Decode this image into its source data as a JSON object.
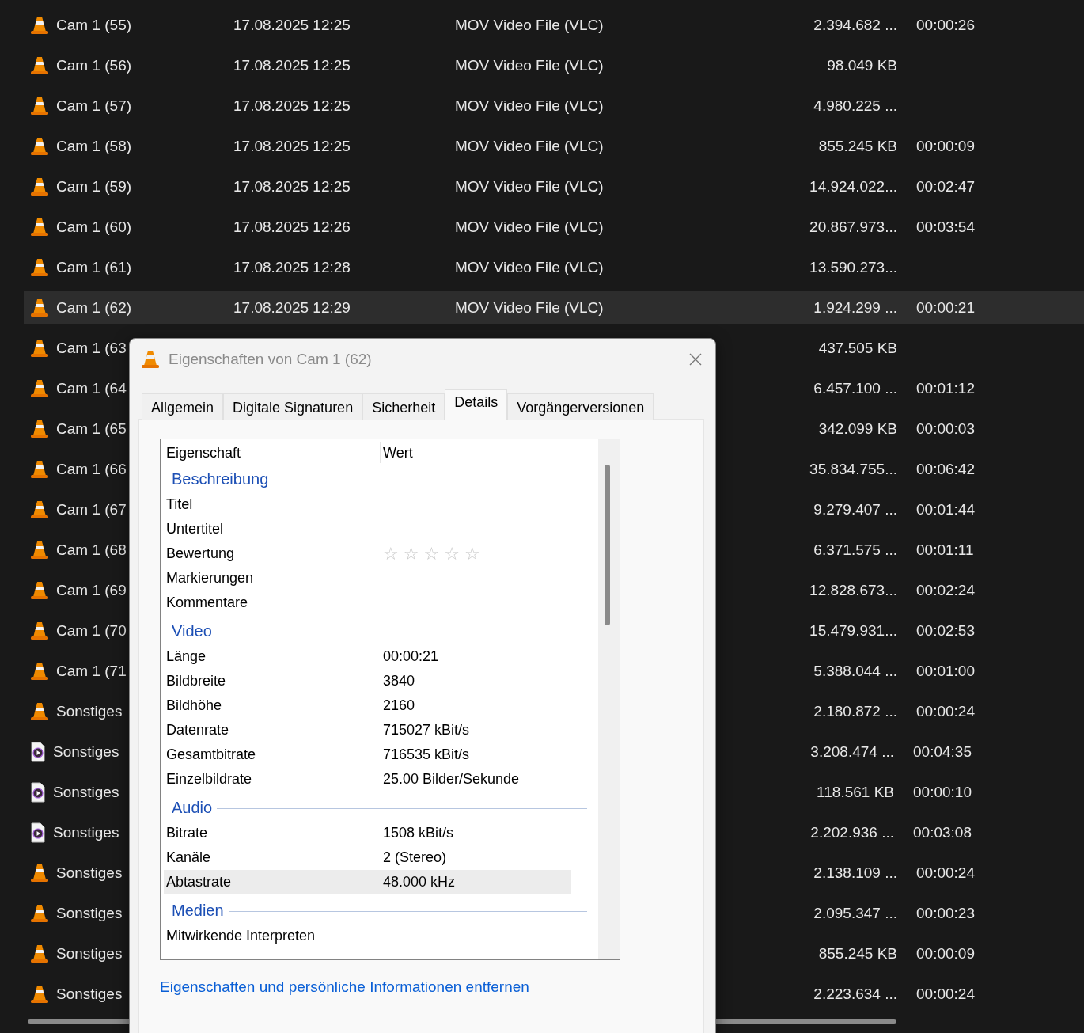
{
  "files": [
    {
      "kind": "vlc",
      "name": "Cam 1 (55)",
      "date": "17.08.2025 12:25",
      "type": "MOV Video File (VLC)",
      "size": "2.394.682 ...",
      "length": "00:00:26",
      "selected": false
    },
    {
      "kind": "vlc",
      "name": "Cam 1 (56)",
      "date": "17.08.2025 12:25",
      "type": "MOV Video File (VLC)",
      "size": "98.049 KB",
      "selected": false
    },
    {
      "kind": "vlc",
      "name": "Cam 1 (57)",
      "date": "17.08.2025 12:25",
      "type": "MOV Video File (VLC)",
      "size": "4.980.225 ...",
      "selected": false
    },
    {
      "kind": "vlc",
      "name": "Cam 1 (58)",
      "date": "17.08.2025 12:25",
      "type": "MOV Video File (VLC)",
      "size": "855.245 KB",
      "length": "00:00:09",
      "selected": false
    },
    {
      "kind": "vlc",
      "name": "Cam 1 (59)",
      "date": "17.08.2025 12:25",
      "type": "MOV Video File (VLC)",
      "size": "14.924.022...",
      "length": "00:02:47",
      "selected": false
    },
    {
      "kind": "vlc",
      "name": "Cam 1 (60)",
      "date": "17.08.2025 12:26",
      "type": "MOV Video File (VLC)",
      "size": "20.867.973...",
      "length": "00:03:54",
      "selected": false
    },
    {
      "kind": "vlc",
      "name": "Cam 1 (61)",
      "date": "17.08.2025 12:28",
      "type": "MOV Video File (VLC)",
      "size": "13.590.273...",
      "selected": false
    },
    {
      "kind": "vlc",
      "name": "Cam 1 (62)",
      "date": "17.08.2025 12:29",
      "type": "MOV Video File (VLC)",
      "size": "1.924.299 ...",
      "length": "00:00:21",
      "selected": true
    },
    {
      "kind": "vlc",
      "name": "Cam 1 (63",
      "size": "437.505 KB",
      "selected": false
    },
    {
      "kind": "vlc",
      "name": "Cam 1 (64",
      "size": "6.457.100 ...",
      "length": "00:01:12",
      "selected": false
    },
    {
      "kind": "vlc",
      "name": "Cam 1 (65",
      "size": "342.099 KB",
      "length": "00:00:03",
      "selected": false
    },
    {
      "kind": "vlc",
      "name": "Cam 1 (66",
      "size": "35.834.755...",
      "length": "00:06:42",
      "selected": false
    },
    {
      "kind": "vlc",
      "name": "Cam 1 (67",
      "size": "9.279.407 ...",
      "length": "00:01:44",
      "selected": false
    },
    {
      "kind": "vlc",
      "name": "Cam 1 (68",
      "size": "6.371.575 ...",
      "length": "00:01:11",
      "selected": false
    },
    {
      "kind": "vlc",
      "name": "Cam 1 (69",
      "size": "12.828.673...",
      "length": "00:02:24",
      "selected": false
    },
    {
      "kind": "vlc",
      "name": "Cam 1 (70",
      "size": "15.479.931...",
      "length": "00:02:53",
      "selected": false
    },
    {
      "kind": "vlc",
      "name": "Cam 1 (71",
      "size": "5.388.044 ...",
      "length": "00:01:00",
      "selected": false
    },
    {
      "kind": "vlc",
      "name": "Sonstiges",
      "size": "2.180.872 ...",
      "length": "00:00:24",
      "selected": false
    },
    {
      "kind": "media",
      "name": "Sonstiges",
      "size": "3.208.474 ...",
      "length": "00:04:35",
      "selected": false
    },
    {
      "kind": "media",
      "name": "Sonstiges",
      "size": "118.561 KB",
      "length": "00:00:10",
      "selected": false
    },
    {
      "kind": "media",
      "name": "Sonstiges",
      "size": "2.202.936 ...",
      "length": "00:03:08",
      "selected": false
    },
    {
      "kind": "vlc",
      "name": "Sonstiges",
      "size": "2.138.109 ...",
      "length": "00:00:24",
      "selected": false
    },
    {
      "kind": "vlc",
      "name": "Sonstiges",
      "size": "2.095.347 ...",
      "length": "00:00:23",
      "selected": false
    },
    {
      "kind": "vlc",
      "name": "Sonstiges",
      "size": "855.245 KB",
      "length": "00:00:09",
      "selected": false
    },
    {
      "kind": "vlc",
      "name": "Sonstiges",
      "size": "2.223.634 ...",
      "length": "00:00:24",
      "selected": false
    }
  ],
  "dialog": {
    "title": "Eigenschaften von Cam 1 (62)",
    "tabs": [
      {
        "label": "Allgemein",
        "selected": false
      },
      {
        "label": "Digitale Signaturen",
        "selected": false
      },
      {
        "label": "Sicherheit",
        "selected": false
      },
      {
        "label": "Details",
        "selected": true
      },
      {
        "label": "Vorgängerversionen",
        "selected": false
      }
    ],
    "columns": [
      "Eigenschaft",
      "Wert"
    ],
    "sections": [
      {
        "title": "Beschreibung",
        "rows": [
          {
            "name": "Titel",
            "selected": false
          },
          {
            "name": "Untertitel",
            "selected": false
          },
          {
            "name": "Bewertung",
            "kind": "stars",
            "stars": 0,
            "selected": false
          },
          {
            "name": "Markierungen",
            "selected": false
          },
          {
            "name": "Kommentare",
            "selected": false
          }
        ]
      },
      {
        "title": "Video",
        "rows": [
          {
            "name": "Länge",
            "value": "00:00:21",
            "selected": false
          },
          {
            "name": "Bildbreite",
            "value": "3840",
            "selected": false
          },
          {
            "name": "Bildhöhe",
            "value": "2160",
            "selected": false
          },
          {
            "name": "Datenrate",
            "value": "715027 kBit/s",
            "selected": false
          },
          {
            "name": "Gesamtbitrate",
            "value": "716535 kBit/s",
            "selected": false
          },
          {
            "name": "Einzelbildrate",
            "value": "25.00 Bilder/Sekunde",
            "selected": false
          }
        ]
      },
      {
        "title": "Audio",
        "rows": [
          {
            "name": "Bitrate",
            "value": "1508 kBit/s",
            "selected": false
          },
          {
            "name": "Kanäle",
            "value": "2 (Stereo)",
            "selected": false
          },
          {
            "name": "Abtastrate",
            "value": "48.000 kHz",
            "selected": true
          }
        ]
      },
      {
        "title": "Medien",
        "rows": [
          {
            "name": "Mitwirkende Interpreten",
            "selected": false
          }
        ]
      }
    ],
    "link": "Eigenschaften und persönliche Informationen entfernen"
  }
}
